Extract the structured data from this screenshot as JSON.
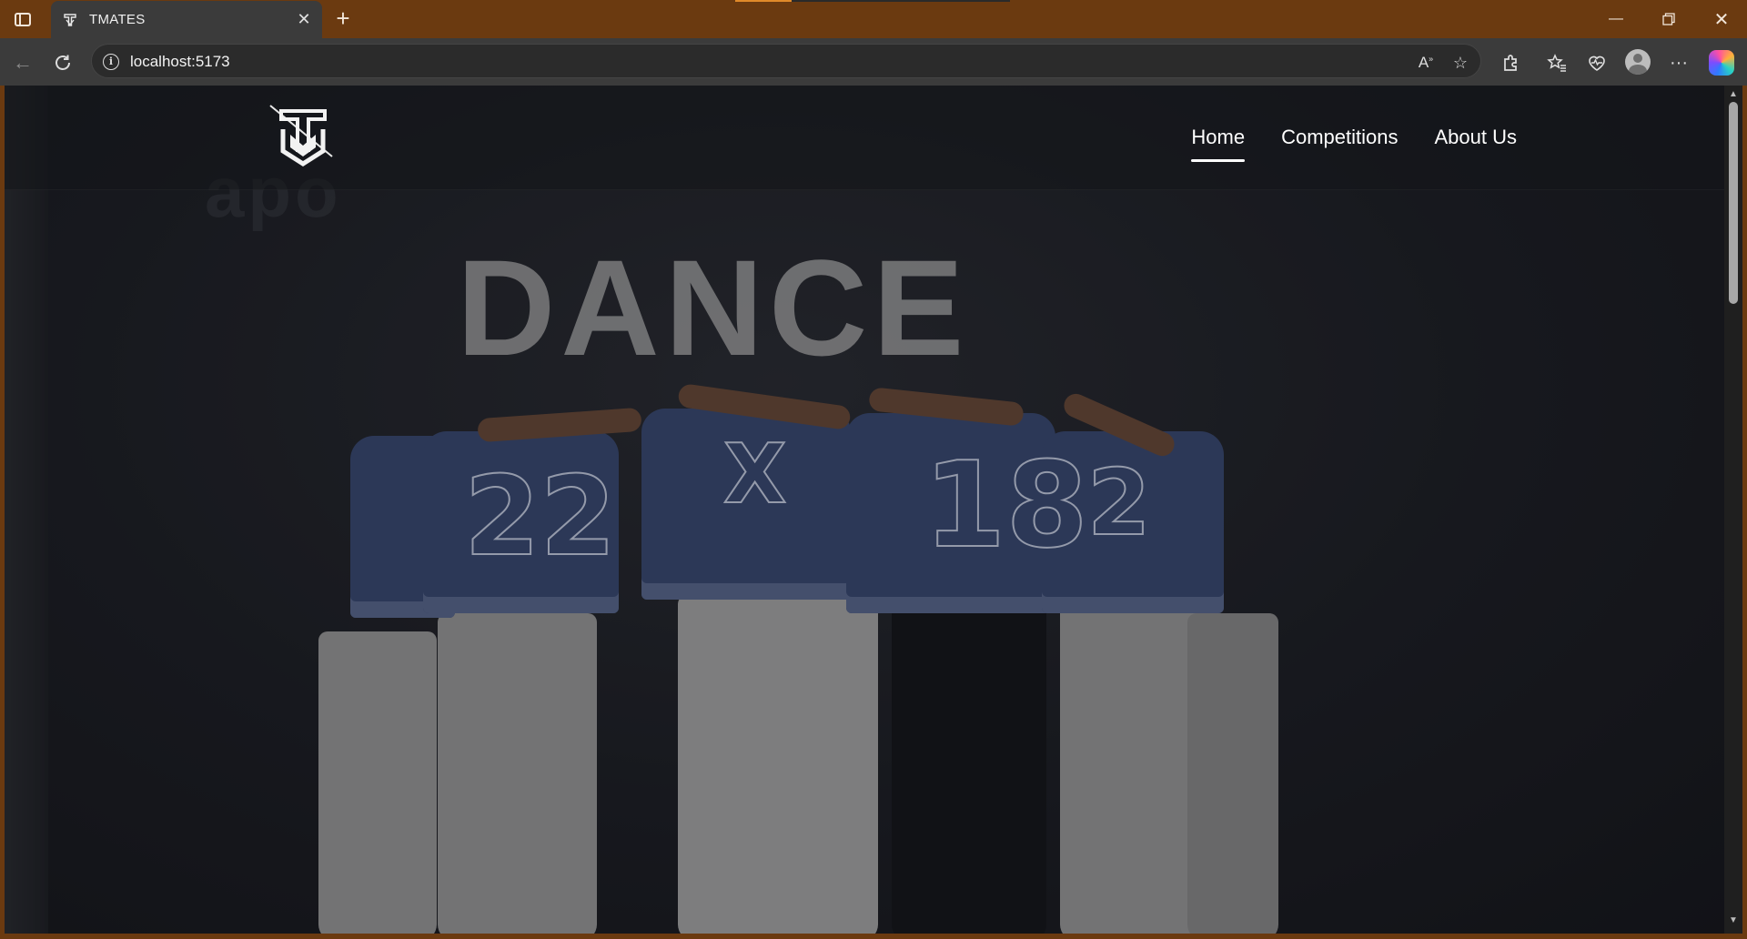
{
  "browser": {
    "tab_title": "TMATES",
    "url": "localhost:5173",
    "accent_color": "#6b3a10"
  },
  "site": {
    "logo_alt": "TMATES logo",
    "nav": [
      {
        "label": "Home",
        "active": true
      },
      {
        "label": "Competitions",
        "active": false
      },
      {
        "label": "About Us",
        "active": false
      }
    ],
    "hero": {
      "backdrop_text": "DANCE"
    }
  },
  "icons": {
    "tab_actions": "sidebar-toggle-icon",
    "favicon": "tmates-favicon-icon",
    "close": "close-icon",
    "new_tab": "plus-icon",
    "back": "back-arrow-icon",
    "refresh": "refresh-icon",
    "site_info": "info-icon",
    "read_aloud": "read-aloud-icon",
    "favorite": "star-icon",
    "extensions": "puzzle-icon",
    "favorites_list": "favorites-icon",
    "health": "heartbeat-icon",
    "profile": "avatar",
    "more": "more-icon",
    "copilot": "copilot-icon"
  }
}
